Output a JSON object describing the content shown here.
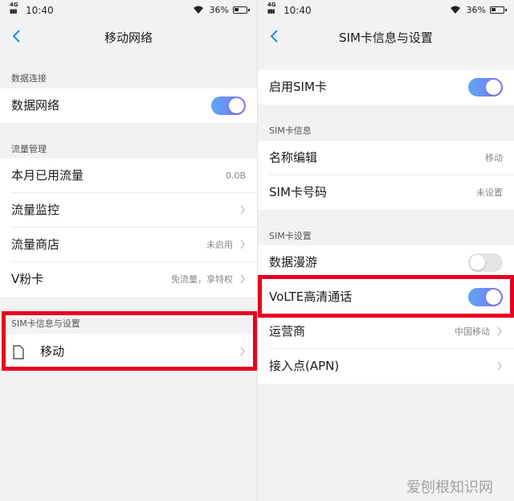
{
  "left": {
    "status": {
      "net": "4G",
      "time": "10:40",
      "battery": "36%"
    },
    "title": "移动网络",
    "sections": {
      "data": {
        "header": "数据连接",
        "data_network": "数据网络",
        "data_network_on": true
      },
      "traffic": {
        "header": "流量管理",
        "used": {
          "label": "本月已用流量",
          "value": "0.0B"
        },
        "monitor": {
          "label": "流量监控"
        },
        "store": {
          "label": "流量商店",
          "value": "未启用"
        },
        "vcard": {
          "label": "V粉卡",
          "value": "免流量，享特权"
        }
      },
      "sim": {
        "header": "SIM卡信息与设置",
        "item": "移动"
      }
    }
  },
  "right": {
    "status": {
      "net": "4G",
      "time": "10:40",
      "battery": "36%"
    },
    "title": "SIM卡信息与设置",
    "enable_sim": {
      "label": "启用SIM卡",
      "on": true
    },
    "info": {
      "header": "SIM卡信息",
      "name": {
        "label": "名称编辑",
        "value": "移动"
      },
      "number": {
        "label": "SIM卡号码",
        "value": "未设置"
      }
    },
    "settings": {
      "header": "SIM卡设置",
      "roaming": {
        "label": "数据漫游",
        "on": false
      },
      "volte": {
        "label": "VoLTE高清通话",
        "on": true
      },
      "carrier": {
        "label": "运营商",
        "value": "中国移动"
      },
      "apn": {
        "label": "接入点(APN)"
      }
    }
  },
  "watermark": "爱刨根知识网",
  "colors": {
    "highlight": "#e8001f",
    "accent": "#1a8bf0",
    "toggle_start": "#5aa8f5",
    "toggle_end": "#8b6ff2"
  }
}
